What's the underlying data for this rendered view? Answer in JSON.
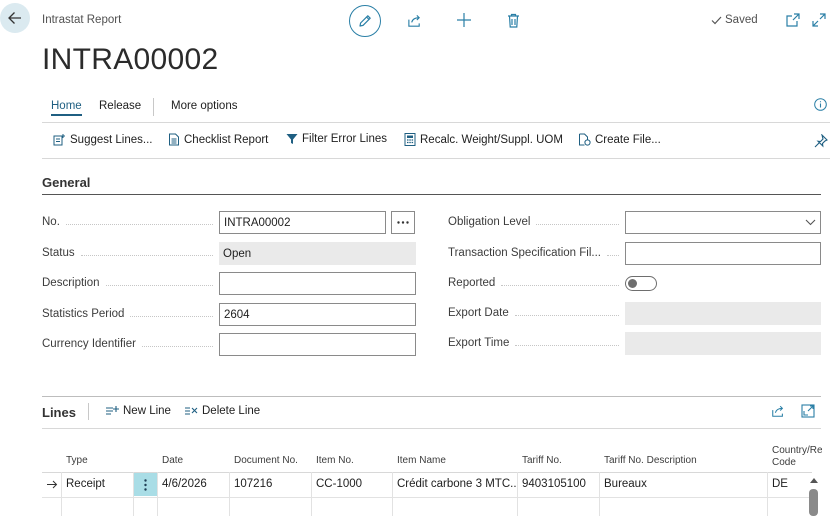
{
  "header": {
    "breadcrumb": "Intrastat Report",
    "status": "Saved",
    "title": "INTRA00002"
  },
  "tabs": [
    {
      "label": "Home"
    },
    {
      "label": "Release"
    },
    {
      "label": "More options"
    }
  ],
  "actions": {
    "suggest_lines": "Suggest Lines...",
    "checklist_report": "Checklist Report",
    "filter_error_lines": "Filter Error Lines",
    "recalc": "Recalc. Weight/Suppl. UOM",
    "create_file": "Create File..."
  },
  "general": {
    "title": "General",
    "no_label": "No.",
    "no_value": "INTRA00002",
    "status_label": "Status",
    "status_value": "Open",
    "description_label": "Description",
    "description_value": "",
    "statistics_period_label": "Statistics Period",
    "statistics_period_value": "2604",
    "currency_identifier_label": "Currency Identifier",
    "currency_identifier_value": "",
    "obligation_level_label": "Obligation Level",
    "obligation_level_value": "",
    "transaction_spec_label": "Transaction Specification Fil...",
    "transaction_spec_value": "",
    "reported_label": "Reported",
    "reported_value": false,
    "export_date_label": "Export Date",
    "export_date_value": "",
    "export_time_label": "Export Time",
    "export_time_value": ""
  },
  "lines": {
    "title": "Lines",
    "new_line": "New Line",
    "delete_line": "Delete Line",
    "columns": {
      "type": "Type",
      "date": "Date",
      "document_no": "Document No.",
      "item_no": "Item No.",
      "item_name": "Item Name",
      "tariff_no": "Tariff No.",
      "tariff_desc": "Tariff No. Description",
      "country_1": "Country/Re",
      "country_2": "Code"
    },
    "rows": [
      {
        "type": "Receipt",
        "date": "4/6/2026",
        "document_no": "107216",
        "item_no": "CC-1000",
        "item_name": "Crédit carbone 3 MTC...",
        "tariff_no": "9403105100",
        "tariff_desc": "Bureaux",
        "country": "DE"
      }
    ]
  },
  "colors": {
    "accent": "#1f5f82",
    "icon_blue": "#2a7fa6",
    "selected_cell": "#a9dde6"
  }
}
